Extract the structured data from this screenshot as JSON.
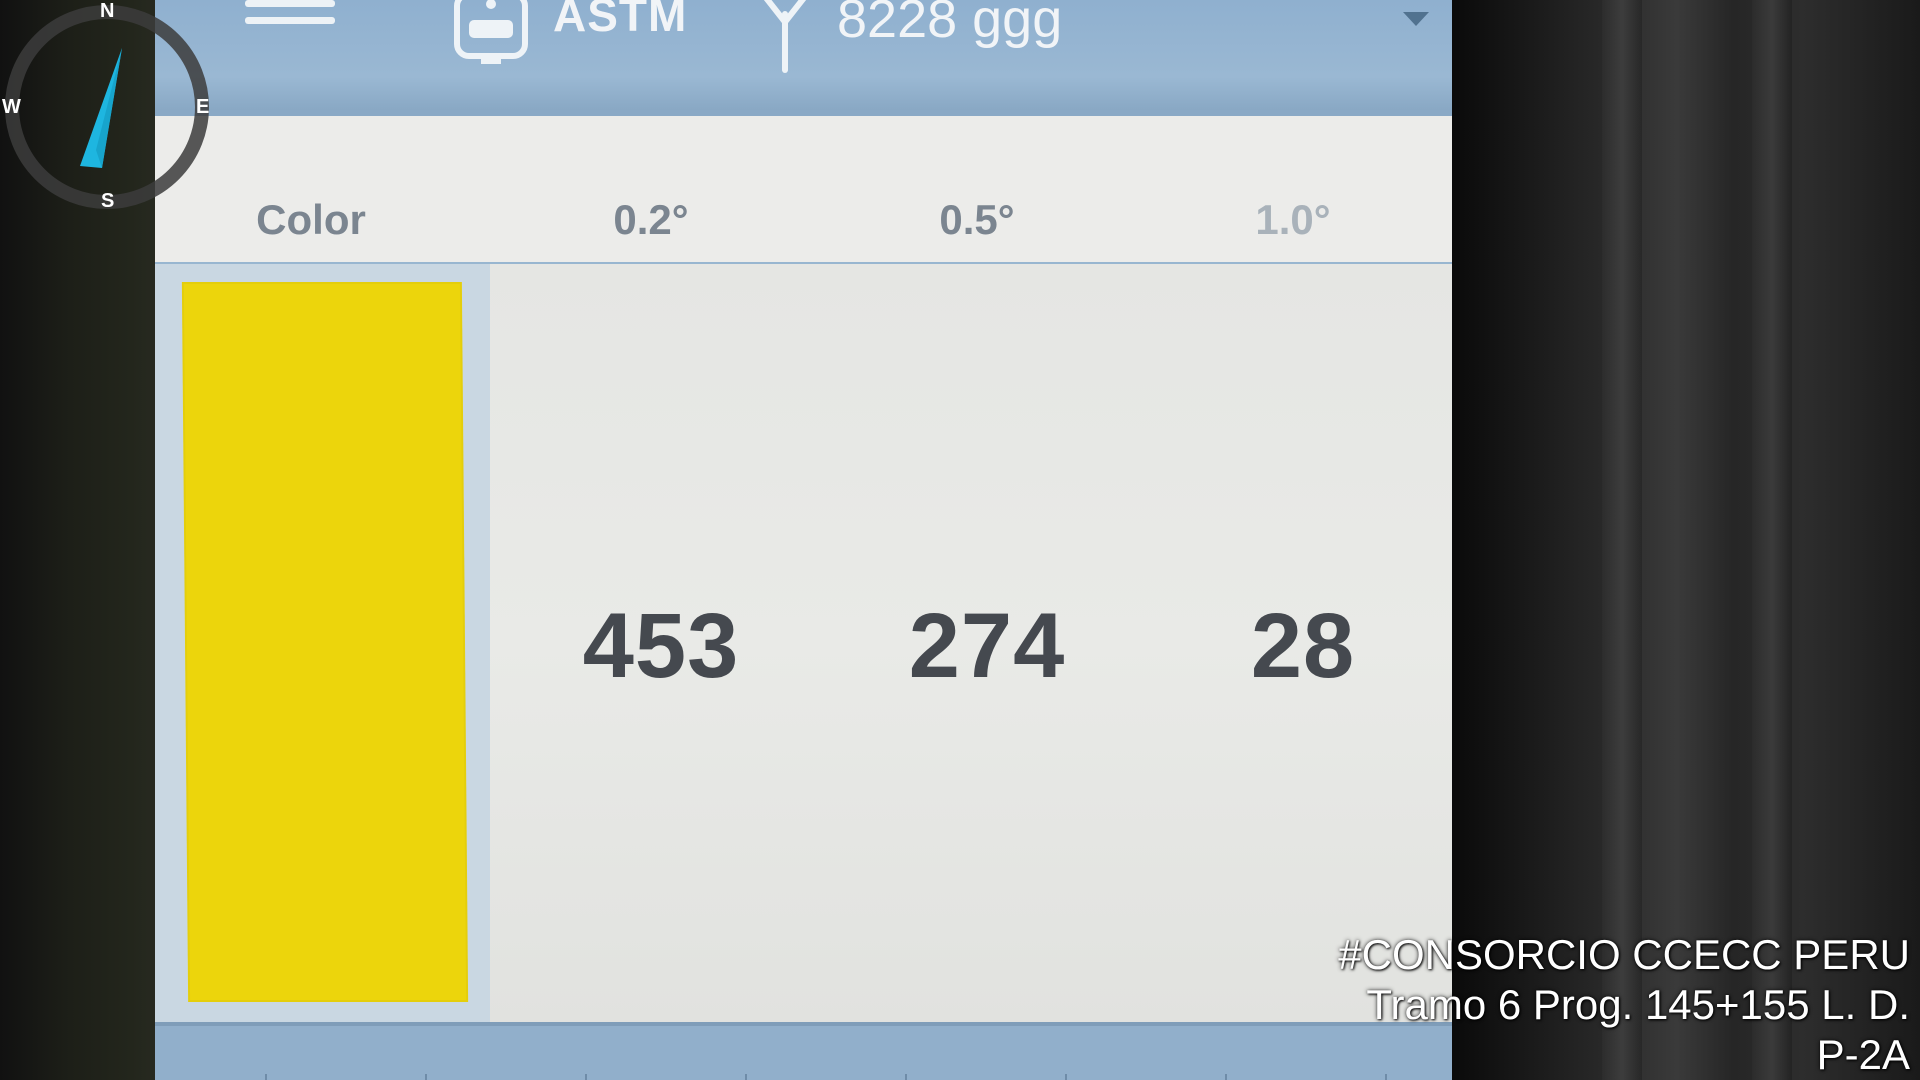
{
  "header": {
    "standard": "ASTM",
    "signal": "8228 ggg"
  },
  "table": {
    "columns": [
      "Color",
      "0.2°",
      "0.5°",
      "1.0°"
    ],
    "row": {
      "color_swatch": "#ecd50c",
      "values": [
        "453",
        "274",
        "28"
      ]
    }
  },
  "compass": {
    "north": "N",
    "east": "E",
    "south": "S",
    "west": "W"
  },
  "watermark": {
    "line1": "#CONSORCIO CCECC PERU",
    "line2": "Tramo 6 Prog. 145+155 L. D.",
    "line3": "P-2A"
  },
  "icons": {
    "menu": "hamburger-menu-icon",
    "device": "retroreflectometer-device-icon",
    "antenna": "antenna-icon",
    "dropdown": "chevron-down-icon",
    "compass": "compass-icon"
  },
  "colors": {
    "topbar": "#9ab8d3",
    "screen_bg": "#e7e8e6",
    "swatch_yellow": "#ecd50c",
    "value_text": "#45494f"
  }
}
